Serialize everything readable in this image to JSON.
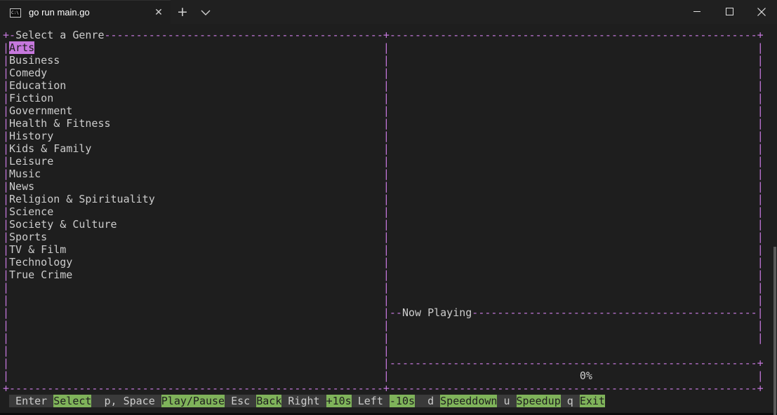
{
  "window": {
    "tab_title": "go run main.go",
    "tab_icon_glyph": "C:\\",
    "new_tab_icon": "plus-icon",
    "close_tab_icon": "close-icon",
    "dropdown_icon": "chevron-down-icon"
  },
  "genre_panel": {
    "title": "Select a Genre",
    "selected_index": 0,
    "genres": [
      "Arts",
      "Business",
      "Comedy",
      "Education",
      "Fiction",
      "Government",
      "Health & Fitness",
      "History",
      "Kids & Family",
      "Leisure",
      "Music",
      "News",
      "Religion & Spirituality",
      "Science",
      "Society & Culture",
      "Sports",
      "TV & Film",
      "Technology",
      "True Crime"
    ]
  },
  "now_playing": {
    "title": "Now Playing",
    "progress_text": "0%"
  },
  "help_bar": [
    {
      "key": " Enter ",
      "desc": "Select"
    },
    {
      "key": "  p, Space ",
      "desc": "Play/Pause"
    },
    {
      "key": " Esc ",
      "desc": "Back"
    },
    {
      "key": " Right ",
      "desc": "+10s"
    },
    {
      "key": " Left ",
      "desc": "-10s"
    },
    {
      "key": "  d ",
      "desc": "Speeddown"
    },
    {
      "key": " u ",
      "desc": "Speedup"
    },
    {
      "key": " q ",
      "desc": "Exit"
    }
  ],
  "colors": {
    "border": "#c678dd",
    "help_desc_bg": "#7fb35a",
    "terminal_bg": "#1e1e1e",
    "text": "#cccccc"
  }
}
